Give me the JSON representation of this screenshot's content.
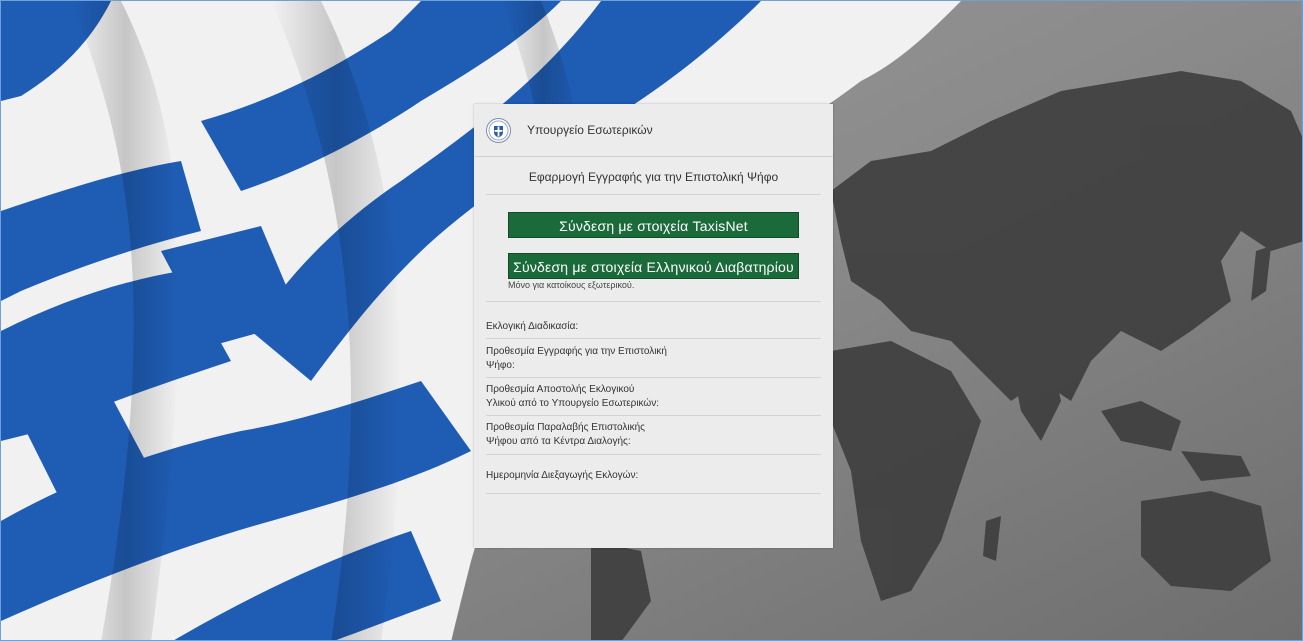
{
  "header": {
    "ministry": "Υπουργείο Εσωτερικών",
    "emblem_icon": "greek-coat-of-arms-icon"
  },
  "app": {
    "title": "Εφαρμογή Εγγραφής για την Επιστολική Ψήφο"
  },
  "login": {
    "taxisnet_label": "Σύνδεση με στοιχεία TaxisNet",
    "passport_label": "Σύνδεση με στοιχεία Ελληνικού Διαβατηρίου",
    "passport_note": "Μόνο για κατοίκους εξωτερικού."
  },
  "info": {
    "rows": [
      "Εκλογική Διαδικασία:",
      "Προθεσμία Εγγραφής για την Επιστολική Ψήφο:",
      "Προθεσμία Αποστολής Εκλογικού Υλικού από το Υπουργείο Εσωτερικών:",
      "Προθεσμία Παραλαβής Επιστολικής Ψήφου από τα Κέντρα Διαλογής:",
      "Ημερομηνία Διεξαγωγής Εκλογών:"
    ]
  },
  "colors": {
    "button": "#1b6b3a",
    "panel": "#ececec",
    "flag_blue": "#1f5db5",
    "flag_white": "#f1f1f1",
    "map_background": "#8a8a8a",
    "map_land": "#3f3f3f"
  }
}
